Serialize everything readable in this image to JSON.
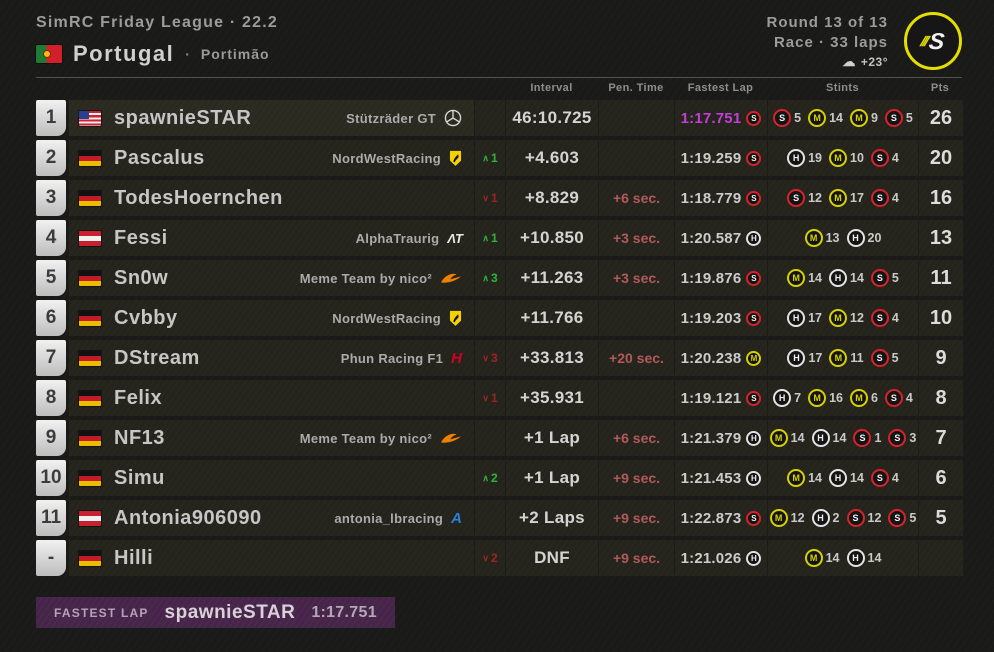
{
  "header": {
    "league_line": "SimRC Friday League · 22.2",
    "country": "Portugal",
    "separator": "·",
    "track": "Portimão",
    "round": "Round 13 of 13",
    "race_info": "Race · 33 laps",
    "weather": {
      "icon": "cloud-icon",
      "temp": "+23°"
    },
    "brand": {
      "slashes": "///",
      "letter": "S"
    }
  },
  "table": {
    "columns": {
      "interval": "Interval",
      "penalty": "Pen. Time",
      "fastest_lap": "Fastest Lap",
      "stints": "Stints",
      "points": "Pts"
    },
    "rows": [
      {
        "pos": "1",
        "flag": "us",
        "name": "spawnieSTAR",
        "team": "Stützräder GT",
        "logo": "mercedes",
        "change": "",
        "interval": "46:10.725",
        "penalty": "",
        "fastest_lap": "1:17.751",
        "fastest_lap_tire": "S",
        "is_overall_fastest": true,
        "highlight": true,
        "stints": [
          {
            "compound": "S",
            "laps": 5
          },
          {
            "compound": "M",
            "laps": 14
          },
          {
            "compound": "M",
            "laps": 9
          },
          {
            "compound": "S",
            "laps": 5
          }
        ],
        "points": "26"
      },
      {
        "pos": "2",
        "flag": "de",
        "name": "Pascalus",
        "team": "NordWestRacing",
        "logo": "ferrari",
        "change": "+1",
        "interval": "+4.603",
        "penalty": "",
        "fastest_lap": "1:19.259",
        "fastest_lap_tire": "S",
        "stints": [
          {
            "compound": "H",
            "laps": 19
          },
          {
            "compound": "M",
            "laps": 10
          },
          {
            "compound": "S",
            "laps": 4
          }
        ],
        "points": "20"
      },
      {
        "pos": "3",
        "flag": "de",
        "name": "TodesHoernchen",
        "team": "",
        "logo": "",
        "change": "-1",
        "interval": "+8.829",
        "penalty": "+6 sec.",
        "fastest_lap": "1:18.779",
        "fastest_lap_tire": "S",
        "stints": [
          {
            "compound": "S",
            "laps": 12
          },
          {
            "compound": "M",
            "laps": 17
          },
          {
            "compound": "S",
            "laps": 4
          }
        ],
        "points": "16"
      },
      {
        "pos": "4",
        "flag": "at",
        "name": "Fessi",
        "team": "AlphaTraurig",
        "logo": "alphatauri",
        "change": "+1",
        "interval": "+10.850",
        "penalty": "+3 sec.",
        "fastest_lap": "1:20.587",
        "fastest_lap_tire": "H",
        "stints": [
          {
            "compound": "M",
            "laps": 13
          },
          {
            "compound": "H",
            "laps": 20
          }
        ],
        "points": "13"
      },
      {
        "pos": "5",
        "flag": "de",
        "name": "Sn0w",
        "team": "Meme Team by nico²",
        "logo": "mclaren",
        "change": "+3",
        "interval": "+11.263",
        "penalty": "+3 sec.",
        "fastest_lap": "1:19.876",
        "fastest_lap_tire": "S",
        "stints": [
          {
            "compound": "M",
            "laps": 14
          },
          {
            "compound": "H",
            "laps": 14
          },
          {
            "compound": "S",
            "laps": 5
          }
        ],
        "points": "11"
      },
      {
        "pos": "6",
        "flag": "de",
        "name": "Cvbby",
        "team": "NordWestRacing",
        "logo": "ferrari",
        "change": "",
        "interval": "+11.766",
        "penalty": "",
        "fastest_lap": "1:19.203",
        "fastest_lap_tire": "S",
        "stints": [
          {
            "compound": "H",
            "laps": 17
          },
          {
            "compound": "M",
            "laps": 12
          },
          {
            "compound": "S",
            "laps": 4
          }
        ],
        "points": "10"
      },
      {
        "pos": "7",
        "flag": "de",
        "name": "DStream",
        "team": "Phun Racing F1",
        "logo": "haas",
        "change": "-3",
        "interval": "+33.813",
        "penalty": "+20 sec.",
        "fastest_lap": "1:20.238",
        "fastest_lap_tire": "M",
        "stints": [
          {
            "compound": "H",
            "laps": 17
          },
          {
            "compound": "M",
            "laps": 11
          },
          {
            "compound": "S",
            "laps": 5
          }
        ],
        "points": "9"
      },
      {
        "pos": "8",
        "flag": "de",
        "name": "Felix",
        "team": "",
        "logo": "",
        "change": "-1",
        "interval": "+35.931",
        "penalty": "",
        "fastest_lap": "1:19.121",
        "fastest_lap_tire": "S",
        "stints": [
          {
            "compound": "H",
            "laps": 7
          },
          {
            "compound": "M",
            "laps": 16
          },
          {
            "compound": "M",
            "laps": 6
          },
          {
            "compound": "S",
            "laps": 4
          }
        ],
        "points": "8"
      },
      {
        "pos": "9",
        "flag": "de",
        "name": "NF13",
        "team": "Meme Team by nico²",
        "logo": "mclaren",
        "change": "",
        "interval": "+1 Lap",
        "penalty": "+6 sec.",
        "fastest_lap": "1:21.379",
        "fastest_lap_tire": "H",
        "stints": [
          {
            "compound": "M",
            "laps": 14
          },
          {
            "compound": "H",
            "laps": 14
          },
          {
            "compound": "S",
            "laps": 1
          },
          {
            "compound": "S",
            "laps": 3
          }
        ],
        "points": "7"
      },
      {
        "pos": "10",
        "flag": "de",
        "name": "Simu",
        "team": "",
        "logo": "",
        "change": "+2",
        "interval": "+1 Lap",
        "penalty": "+9 sec.",
        "fastest_lap": "1:21.453",
        "fastest_lap_tire": "H",
        "stints": [
          {
            "compound": "M",
            "laps": 14
          },
          {
            "compound": "H",
            "laps": 14
          },
          {
            "compound": "S",
            "laps": 4
          }
        ],
        "points": "6"
      },
      {
        "pos": "11",
        "flag": "at",
        "name": "Antonia906090",
        "team": "antonia_lbracing",
        "logo": "alpine",
        "change": "",
        "interval": "+2 Laps",
        "penalty": "+9 sec.",
        "fastest_lap": "1:22.873",
        "fastest_lap_tire": "S",
        "stints": [
          {
            "compound": "M",
            "laps": 12
          },
          {
            "compound": "H",
            "laps": 2
          },
          {
            "compound": "S",
            "laps": 12
          },
          {
            "compound": "S",
            "laps": 5
          }
        ],
        "points": "5"
      },
      {
        "pos": "-",
        "flag": "de",
        "name": "Hilli",
        "team": "",
        "logo": "",
        "change": "-2",
        "interval": "DNF",
        "penalty": "+9 sec.",
        "fastest_lap": "1:21.026",
        "fastest_lap_tire": "H",
        "stints": [
          {
            "compound": "M",
            "laps": 14
          },
          {
            "compound": "H",
            "laps": 14
          }
        ],
        "points": ""
      }
    ]
  },
  "footer": {
    "label": "FASTEST LAP",
    "driver": "spawnieSTAR",
    "time": "1:17.751"
  },
  "colors": {
    "fastest_lap_purple": "#c43fd6",
    "tire_soft": "#d8232a",
    "tire_medium": "#d6d000",
    "tire_hard": "#e3e3e3",
    "gain_green": "#2cb53c",
    "loss_red": "#9e2424",
    "penalty_red": "#b25a5a",
    "brand_yellow": "#e4de00",
    "footer_purple": "#47254a"
  }
}
